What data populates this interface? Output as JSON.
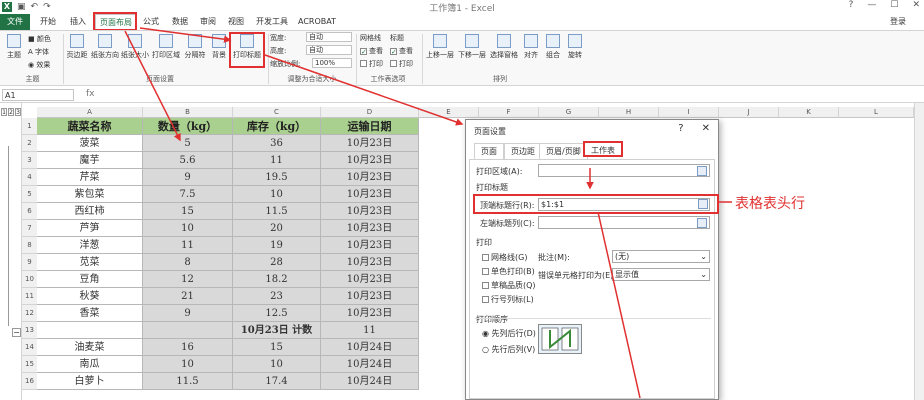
{
  "window": {
    "title": "工作簿1 - Excel",
    "controls": [
      "?",
      "—",
      "☐",
      "✕"
    ]
  },
  "tabs": [
    "文件",
    "开始",
    "插入",
    "页面布局",
    "公式",
    "数据",
    "审阅",
    "视图",
    "开发工具",
    "ACROBAT"
  ],
  "login": "登录",
  "ribbon": {
    "theme": {
      "main": "主题",
      "colors": "颜色",
      "fonts": "字体",
      "effects": "效果",
      "group": "主题"
    },
    "page_setup": {
      "buttons": [
        "页边距",
        "纸张方向",
        "纸张大小",
        "打印区域",
        "分隔符",
        "背景",
        "打印标题"
      ],
      "group": "页面设置"
    },
    "scale": {
      "width_label": "宽度:",
      "width_val": "自动",
      "height_label": "高度:",
      "height_val": "自动",
      "scale_label": "缩放比例:",
      "scale_val": "100%",
      "group": "调整为合适大小"
    },
    "sheet_opts": {
      "gridlines": "网格线",
      "headings": "标题",
      "view": "查看",
      "print": "打印",
      "group": "工作表选项"
    },
    "arrange": {
      "buttons": [
        "上移一层",
        "下移一层",
        "选择窗格",
        "对齐",
        "组合",
        "旋转"
      ],
      "group": "排列"
    }
  },
  "formula_bar": {
    "name_box": "A1",
    "fx": "fx"
  },
  "columns": [
    "A",
    "B",
    "C",
    "D",
    "E",
    "F",
    "G",
    "H",
    "I",
    "J",
    "K",
    "L"
  ],
  "outline_levels": [
    "1",
    "2",
    "3"
  ],
  "table": {
    "headers": [
      "蔬菜名称",
      "数量（kg）",
      "库存（kg）",
      "运输日期"
    ],
    "rows": [
      [
        "2",
        "菠菜",
        "5",
        "36",
        "10月23日"
      ],
      [
        "3",
        "魔芋",
        "5.6",
        "11",
        "10月23日"
      ],
      [
        "4",
        "芹菜",
        "9",
        "19.5",
        "10月23日"
      ],
      [
        "5",
        "紫包菜",
        "7.5",
        "10",
        "10月23日"
      ],
      [
        "6",
        "西红柿",
        "15",
        "11.5",
        "10月23日"
      ],
      [
        "7",
        "芦笋",
        "10",
        "20",
        "10月23日"
      ],
      [
        "8",
        "洋葱",
        "11",
        "19",
        "10月23日"
      ],
      [
        "9",
        "苋菜",
        "8",
        "28",
        "10月23日"
      ],
      [
        "10",
        "豆角",
        "12",
        "18.2",
        "10月23日"
      ],
      [
        "11",
        "秋葵",
        "21",
        "23",
        "10月23日"
      ],
      [
        "12",
        "香菜",
        "9",
        "12.5",
        "10月23日"
      ],
      [
        "13",
        "",
        "",
        "10月23日 计数",
        "11"
      ],
      [
        "14",
        "油麦菜",
        "16",
        "15",
        "10月24日"
      ],
      [
        "15",
        "南瓜",
        "10",
        "10",
        "10月24日"
      ],
      [
        "16",
        "白萝卜",
        "11.5",
        "17.4",
        "10月24日"
      ]
    ]
  },
  "dialog": {
    "title": "页面设置",
    "tabs": [
      "页面",
      "页边距",
      "页眉/页脚",
      "工作表"
    ],
    "print_area_label": "打印区域(A):",
    "print_titles_label": "打印标题",
    "top_rows_label": "顶端标题行(R):",
    "top_rows_value": "$1:$1",
    "left_cols_label": "左端标题列(C):",
    "print_label": "打印",
    "gridlines": "网格线(G)",
    "mono": "单色打印(B)",
    "draft": "草稿品质(Q)",
    "rowcol": "行号列标(L)",
    "comments_label": "批注(M):",
    "comments_value": "(无)",
    "errors_label": "错误单元格打印为(E):",
    "errors_value": "显示值",
    "order_label": "打印顺序",
    "down_then_over": "先列后行(D)",
    "over_then_down": "先行后列(V)"
  },
  "annotation": "表格表头行"
}
